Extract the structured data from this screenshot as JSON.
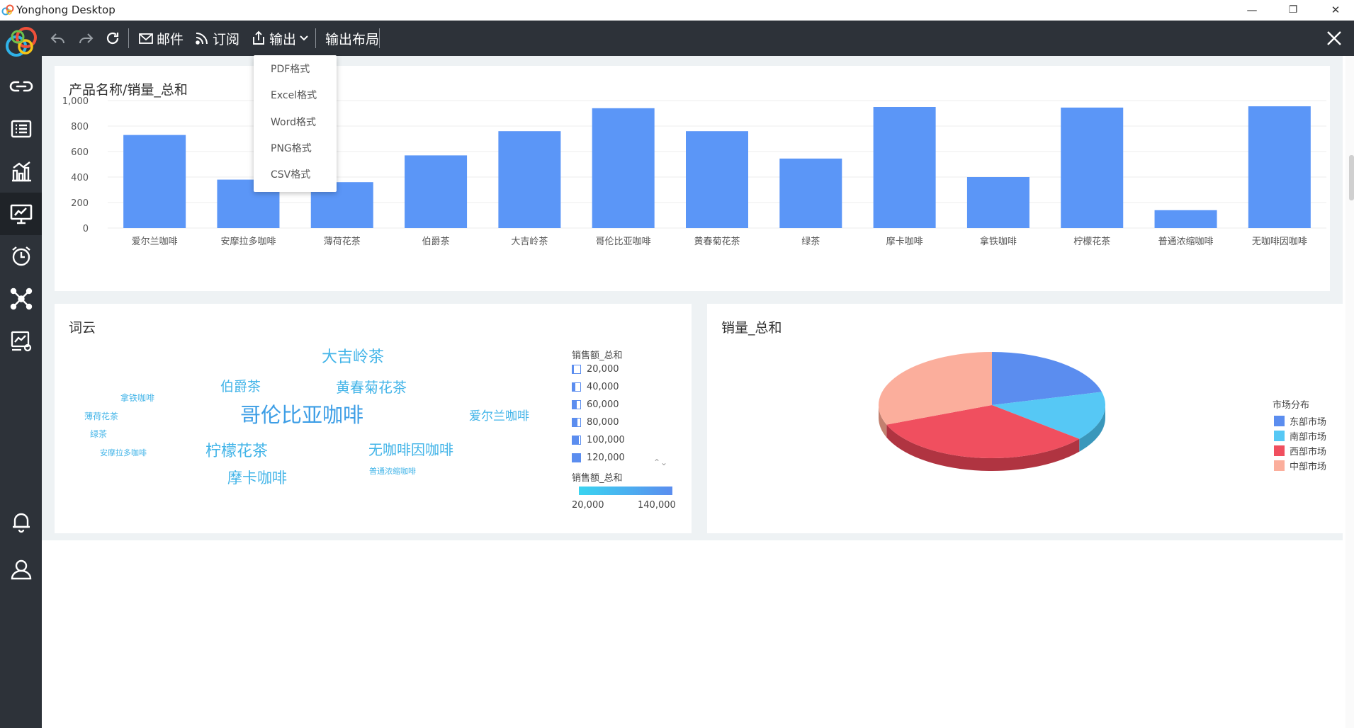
{
  "window": {
    "title": "Yonghong Desktop",
    "controls": {
      "minimize": "—",
      "maximize": "❐",
      "close": "✕"
    }
  },
  "sidebar": {
    "items": [
      {
        "icon": "link-icon"
      },
      {
        "icon": "list-icon"
      },
      {
        "icon": "bar-chart-icon"
      },
      {
        "icon": "dashboard-icon",
        "active": true
      },
      {
        "icon": "alarm-clock-icon"
      },
      {
        "icon": "network-icon"
      },
      {
        "icon": "report-settings-icon"
      },
      {
        "icon": "bell-icon"
      },
      {
        "icon": "user-icon"
      }
    ]
  },
  "toolbar": {
    "undo_icon": "undo-icon",
    "redo_icon": "redo-icon",
    "refresh_icon": "refresh-icon",
    "mail_label": "邮件",
    "subscribe_label": "订阅",
    "export_label": "输出",
    "layout_label": "输出布局",
    "close_icon": "close-icon"
  },
  "export_menu": {
    "items": [
      "PDF格式",
      "Excel格式",
      "Word格式",
      "PNG格式",
      "CSV格式"
    ]
  },
  "bar_panel": {
    "title": "产品名称/销量_总和",
    "chart_data": {
      "type": "bar",
      "title": "产品名称/销量_总和",
      "categories": [
        "爱尔兰咖啡",
        "安摩拉多咖啡",
        "薄荷花茶",
        "伯爵茶",
        "大吉岭茶",
        "哥伦比亚咖啡",
        "黄春菊花茶",
        "绿茶",
        "摩卡咖啡",
        "拿铁咖啡",
        "柠檬花茶",
        "普通浓缩咖啡",
        "无咖啡因咖啡"
      ],
      "values": [
        730,
        380,
        360,
        570,
        760,
        940,
        760,
        545,
        950,
        400,
        945,
        140,
        955
      ],
      "ylim": [
        0,
        1000
      ],
      "yticks": [
        "0",
        "200",
        "400",
        "600",
        "800",
        "1,000"
      ],
      "grid": true,
      "color": "#5b96f7"
    }
  },
  "wordcloud_panel": {
    "title": "词云",
    "words": [
      {
        "text": "大吉岭茶",
        "size": 22
      },
      {
        "text": "伯爵茶",
        "size": 19
      },
      {
        "text": "黄春菊花茶",
        "size": 20
      },
      {
        "text": "拿铁咖啡",
        "size": 12
      },
      {
        "text": "薄荷花茶",
        "size": 12
      },
      {
        "text": "哥伦比亚咖啡",
        "size": 29
      },
      {
        "text": "爱尔兰咖啡",
        "size": 17
      },
      {
        "text": "绿茶",
        "size": 12
      },
      {
        "text": "柠檬花茶",
        "size": 22
      },
      {
        "text": "无咖啡因咖啡",
        "size": 20
      },
      {
        "text": "安摩拉多咖啡",
        "size": 11
      },
      {
        "text": "摩卡咖啡",
        "size": 21
      },
      {
        "text": "普通浓缩咖啡",
        "size": 11
      }
    ],
    "size_legend": {
      "title": "销售额_总和",
      "items": [
        {
          "label": "20,000",
          "level": 0.17
        },
        {
          "label": "40,000",
          "level": 0.33
        },
        {
          "label": "60,000",
          "level": 0.5
        },
        {
          "label": "80,000",
          "level": 0.67
        },
        {
          "label": "100,000",
          "level": 0.83
        },
        {
          "label": "120,000",
          "level": 1.0
        }
      ]
    },
    "color_legend": {
      "title": "销售额_总和",
      "min": "20,000",
      "max": "140,000"
    },
    "scroll_arrows": "⌃⌄"
  },
  "pie_panel": {
    "title": "销量_总和",
    "chart_data": {
      "type": "pie",
      "title": "销量_总和",
      "legend_title": "市场分布",
      "legend_position": "right",
      "slices": [
        {
          "label": "东部市场",
          "value": 21,
          "color": "#5b8def",
          "dark": "#3d67b8"
        },
        {
          "label": "南部市场",
          "value": 15,
          "color": "#56c8f5",
          "dark": "#3a97bb"
        },
        {
          "label": "西部市场",
          "value": 33,
          "color": "#f04f5f",
          "dark": "#b03441"
        },
        {
          "label": "中部市场",
          "value": 31,
          "color": "#fbae9c",
          "dark": "#c2806f"
        }
      ]
    }
  }
}
